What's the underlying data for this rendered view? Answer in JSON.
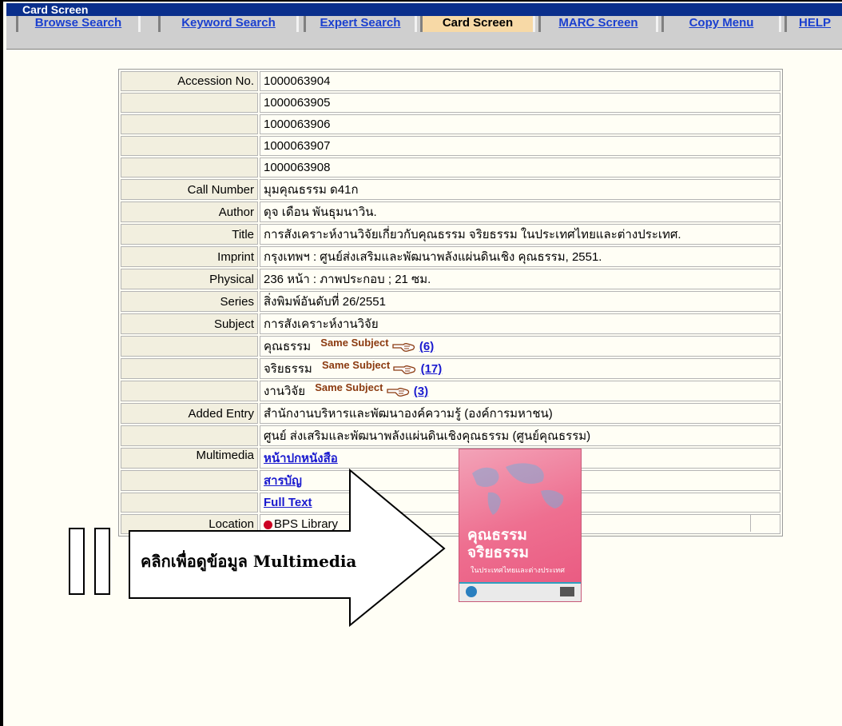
{
  "window": {
    "title": "Card Screen"
  },
  "tabs": [
    {
      "label": "Browse Search"
    },
    {
      "label": "Keyword Search"
    },
    {
      "label": "Expert Search"
    },
    {
      "label": "Card Screen"
    },
    {
      "label": "MARC Screen"
    },
    {
      "label": "Copy Menu"
    },
    {
      "label": "HELP"
    }
  ],
  "record": {
    "accession_label": "Accession No.",
    "accession_numbers": [
      "1000063904",
      "1000063905",
      "1000063906",
      "1000063907",
      "1000063908"
    ],
    "call_number_label": "Call Number",
    "call_number": "มุมคุณธรรม ด41ก",
    "author_label": "Author",
    "author": "ดุจ เดือน พันธุมนาวิน.",
    "title_label": "Title",
    "title": "การสังเคราะห์งานวิจัยเกี่ยวกับคุณธรรม จริยธรรม ในประเทศไทยและต่างประเทศ.",
    "imprint_label": "Imprint",
    "imprint": "กรุงเทพฯ : ศูนย์ส่งเสริมและพัฒนาพลังแผ่นดินเชิง คุณธรรม, 2551.",
    "physical_label": "Physical",
    "physical": "236 หน้า : ภาพประกอบ ; 21 ซม.",
    "series_label": "Series",
    "series": "สิ่งพิมพ์อันดับที่ 26/2551",
    "subject_label": "Subject",
    "subject_main": "การสังเคราะห์งานวิจัย",
    "subjects": [
      {
        "term": "คุณธรรม",
        "same_label": "Same Subject",
        "count": "(6)"
      },
      {
        "term": "จริยธรรม",
        "same_label": "Same Subject",
        "count": "(17)"
      },
      {
        "term": "งานวิจัย",
        "same_label": "Same Subject",
        "count": "(3)"
      }
    ],
    "added_entry_label": "Added Entry",
    "added_entries": [
      "สำนักงานบริหารและพัฒนาองค์ความรู้ (องค์การมหาชน)",
      "ศูนย์ ส่งเสริมและพัฒนาพลังแผ่นดินเชิงคุณธรรม (ศูนย์คุณธรรม)"
    ],
    "multimedia_label": "Multimedia",
    "multimedia_link": "หน้าปกหนังสือ",
    "toc_link": "สารบัญ",
    "fulltext_link": "Full Text",
    "location_label": "Location",
    "location": "BPS Library"
  },
  "cover": {
    "title_line1": "คุณธรรม",
    "title_line2": "จริยธรรม",
    "subtitle": "ในประเทศไทยและต่างประเทศ"
  },
  "annotation": {
    "arrow_text": "คลิกเพื่อดูข้อมูล Multimedia"
  },
  "colors": {
    "title_bar": "#0a2f8c",
    "active_tab": "#f7d9a6",
    "link": "#1a1acf",
    "same_subject": "#8b3a10",
    "location_dot": "#cc0022"
  }
}
